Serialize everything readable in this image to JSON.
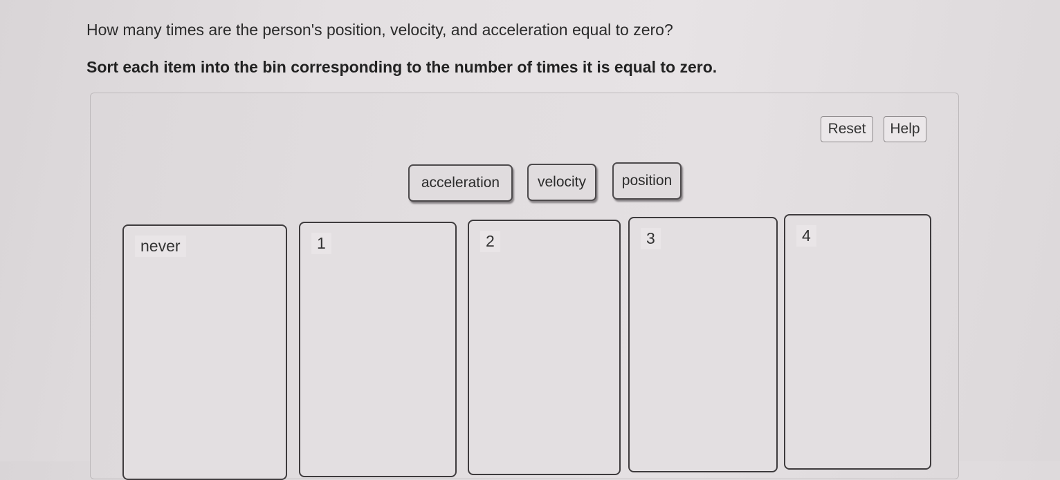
{
  "question": "How many times are the person's position, velocity, and acceleration equal to zero?",
  "instruction": "Sort each item into the bin corresponding to the number of times it is equal to zero.",
  "toolbar": {
    "reset_label": "Reset",
    "help_label": "Help"
  },
  "items": [
    {
      "label": "acceleration"
    },
    {
      "label": "velocity"
    },
    {
      "label": "position"
    }
  ],
  "bins": [
    {
      "label": "never"
    },
    {
      "label": "1"
    },
    {
      "label": "2"
    },
    {
      "label": "3"
    },
    {
      "label": "4"
    }
  ]
}
